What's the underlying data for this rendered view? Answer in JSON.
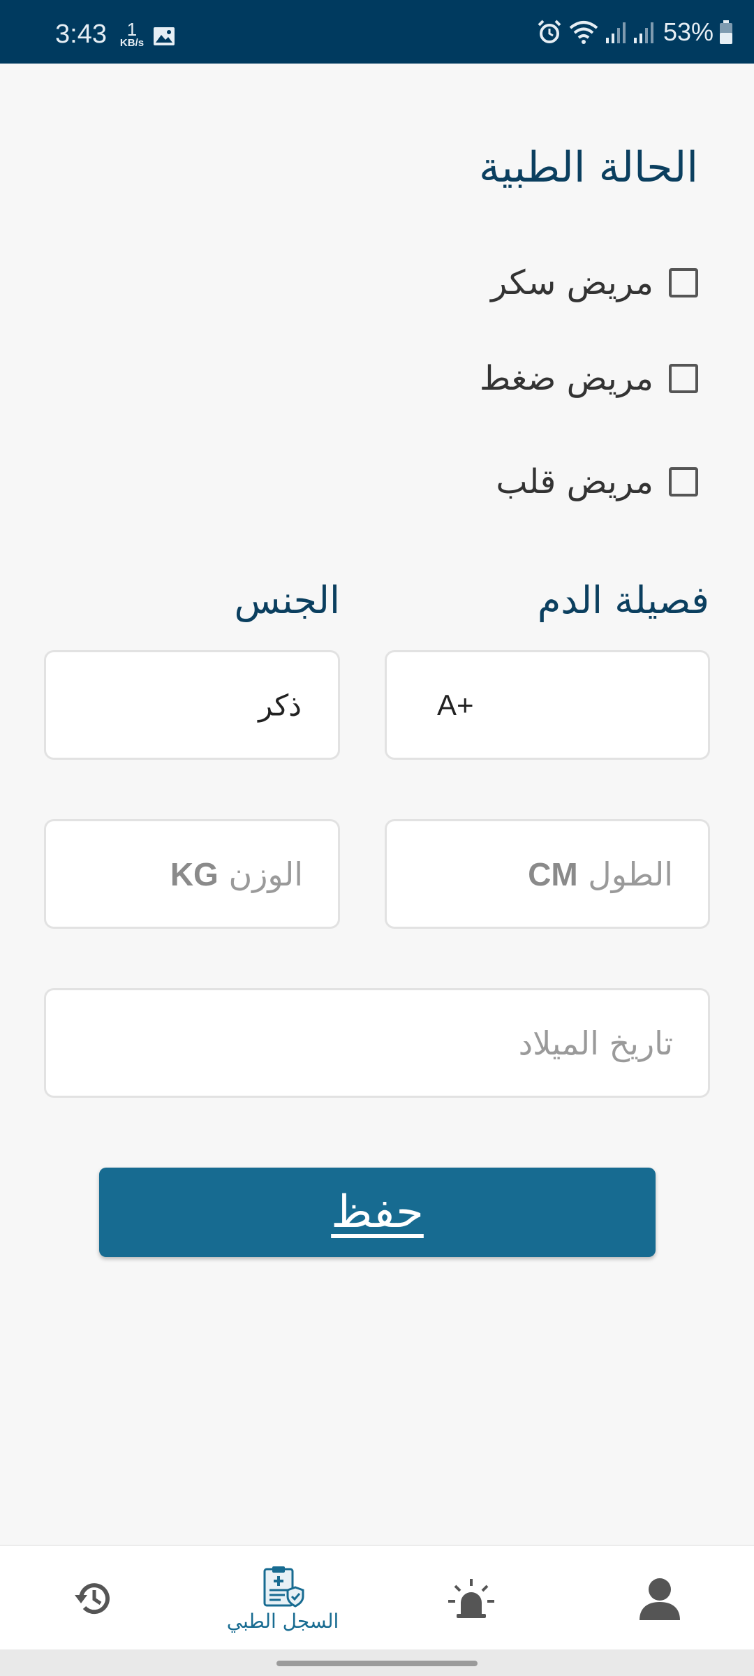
{
  "status_bar": {
    "time": "3:43",
    "net_speed_value": "1",
    "net_speed_unit": "KB/s",
    "battery": "53%"
  },
  "medical_condition": {
    "title": "الحالة الطبية",
    "options": [
      {
        "label": "مريض سكر",
        "checked": false
      },
      {
        "label": "مريض ضغط",
        "checked": false
      },
      {
        "label": "مريض قلب",
        "checked": false
      }
    ]
  },
  "blood_type": {
    "label": "فصيلة الدم",
    "value": "A+"
  },
  "gender": {
    "label": "الجنس",
    "value": "ذكر"
  },
  "height": {
    "placeholder_text": "الطول",
    "unit": "CM"
  },
  "weight": {
    "placeholder_text": "الوزن",
    "unit": "KG"
  },
  "birth_date": {
    "placeholder": "تاريخ الميلاد"
  },
  "save_button": {
    "label": "حفظ"
  },
  "bottom_nav": {
    "items": [
      {
        "icon": "history-icon",
        "label": ""
      },
      {
        "icon": "medical-record-icon",
        "label": "السجل الطبي",
        "active": true
      },
      {
        "icon": "alarm-siren-icon",
        "label": ""
      },
      {
        "icon": "profile-icon",
        "label": ""
      }
    ]
  },
  "colors": {
    "status_bar": "#003a5f",
    "primary": "#176b91",
    "title": "#0b3f5f",
    "background": "#f7f7f7"
  }
}
